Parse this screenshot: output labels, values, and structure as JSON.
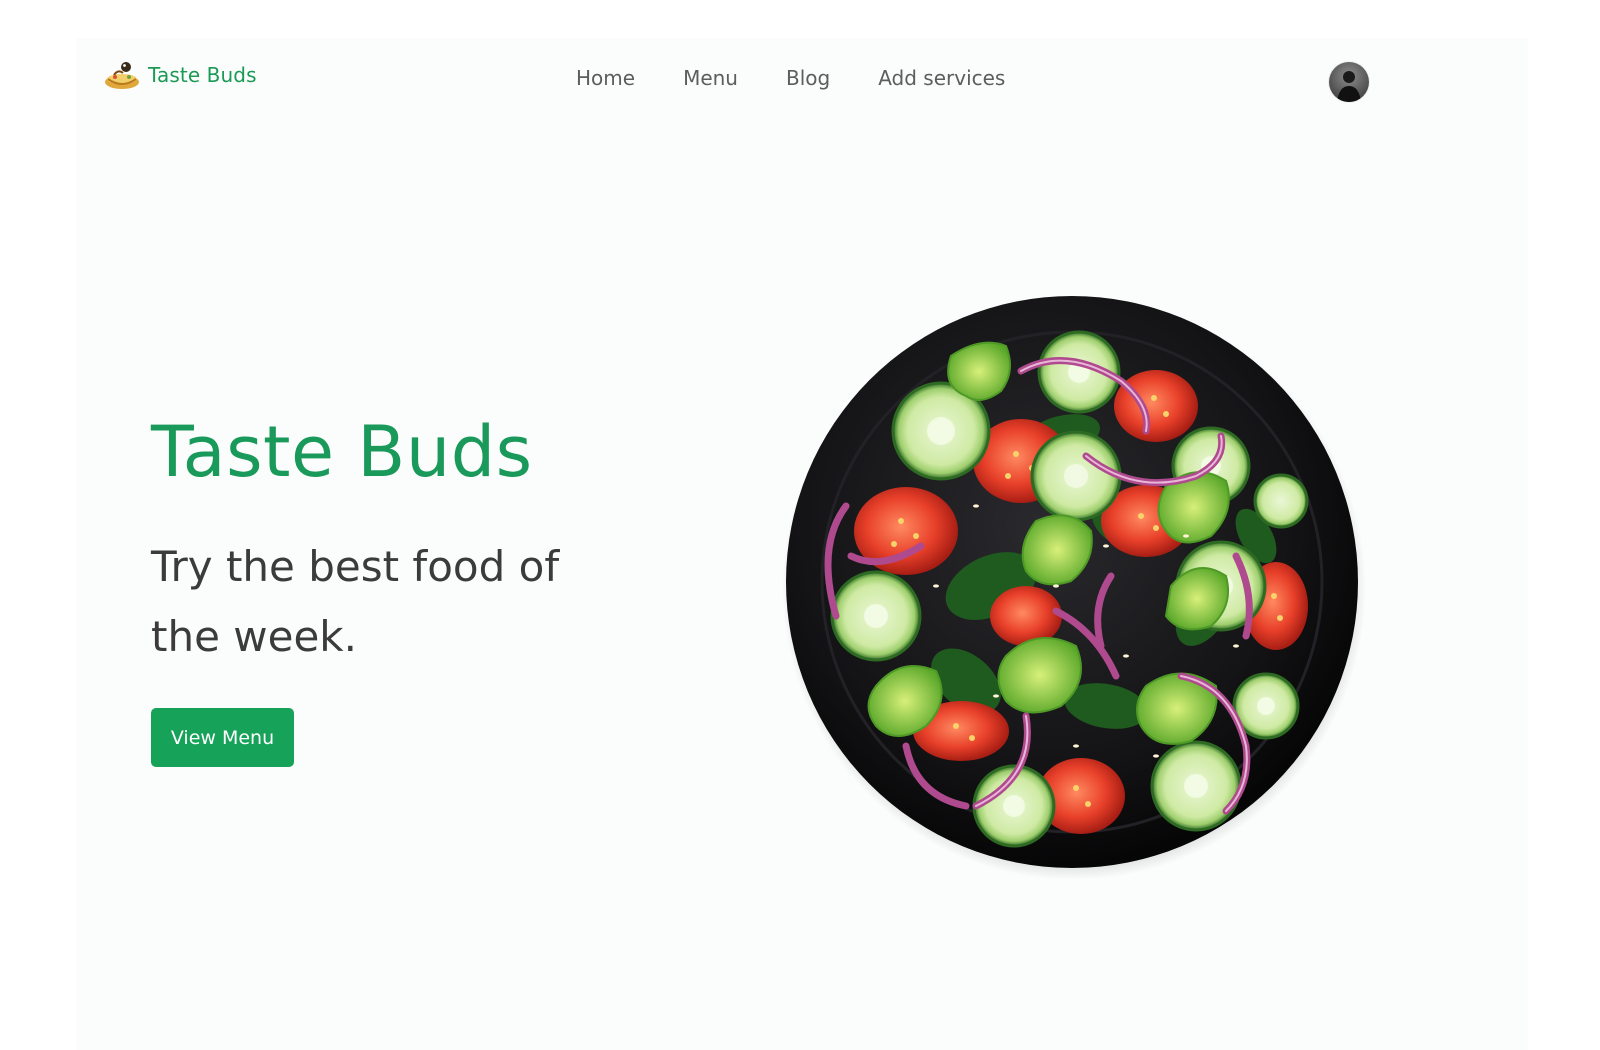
{
  "brand": {
    "name": "Taste Buds",
    "logo_icon": "food-bowl-logo-icon"
  },
  "nav": {
    "links": [
      "Home",
      "Menu",
      "Blog",
      "Add services"
    ]
  },
  "user": {
    "avatar_icon": "user-avatar"
  },
  "hero": {
    "title": "Taste Buds",
    "subtitle": "Try the best food of the week.",
    "cta_label": "View Menu",
    "image_icon": "salad-plate-image"
  },
  "colors": {
    "brand_green": "#19995a",
    "button_green": "#17a259",
    "nav_text": "#5d5d5d",
    "body_text": "#3b3b3b",
    "background": "#fbfcfc"
  }
}
